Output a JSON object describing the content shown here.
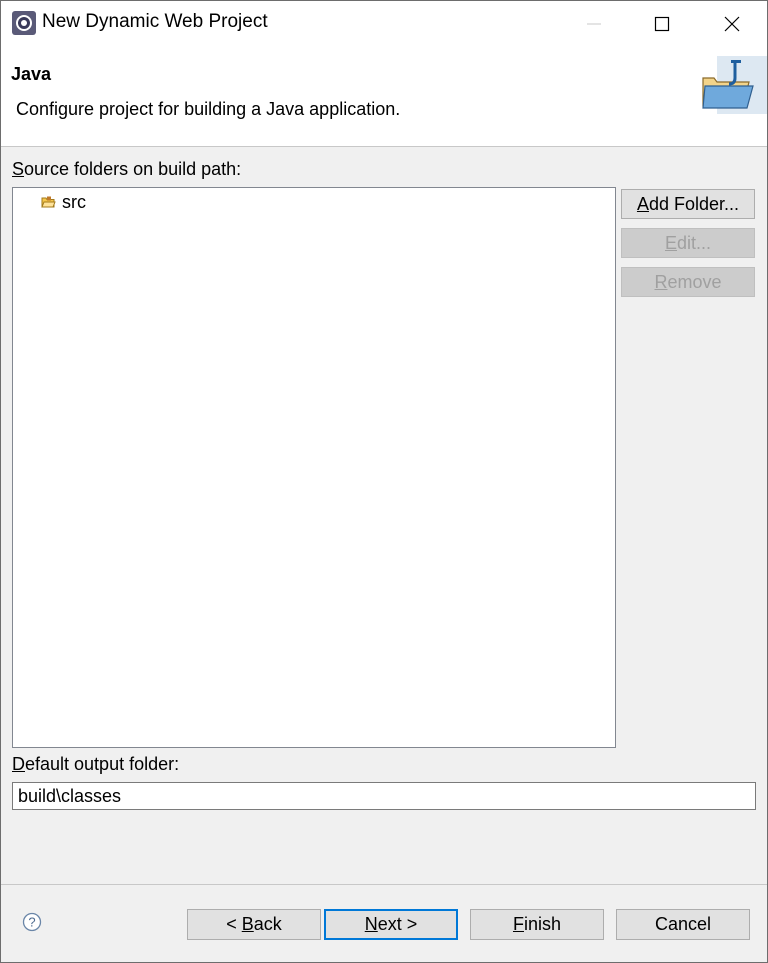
{
  "window": {
    "title": "New Dynamic Web Project",
    "controls": {
      "minimize": "minimize-icon",
      "maximize": "maximize-icon",
      "close": "close-icon"
    }
  },
  "header": {
    "title": "Java",
    "description": "Configure project for building a Java application."
  },
  "source_folders": {
    "label_mnemonic": "S",
    "label_rest": "ource folders on build path:",
    "items": [
      {
        "label": "src",
        "icon": "source-folder-icon"
      }
    ]
  },
  "side_buttons": {
    "add_mnemonic": "A",
    "add_rest": "dd Folder...",
    "edit_mnemonic": "E",
    "edit_rest": "dit...",
    "remove_mnemonic": "R",
    "remove_rest": "emove"
  },
  "output": {
    "label_mnemonic": "D",
    "label_rest": "efault output folder:",
    "value": "build\\classes"
  },
  "footer": {
    "back_prefix": "< ",
    "back_mnemonic": "B",
    "back_rest": "ack",
    "next_mnemonic": "N",
    "next_rest": "ext >",
    "finish_mnemonic": "F",
    "finish_rest": "inish",
    "cancel": "Cancel"
  },
  "colors": {
    "accent": "#0078d7",
    "disabled_text": "#a0a0a0"
  }
}
